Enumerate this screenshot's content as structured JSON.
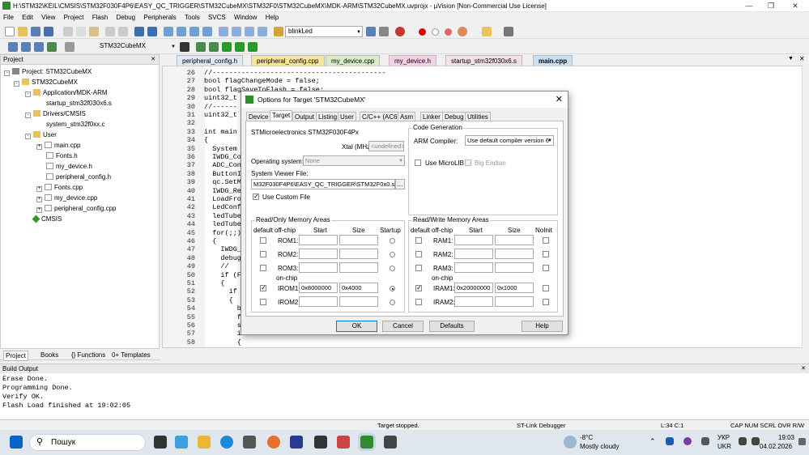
{
  "window": {
    "title": "H:\\STM32\\KEIL\\CMSIS\\STM32F030F4P6\\EASY_QC_TRIGGER\\STM32CubeMX\\STM32F0\\STM32CubeMX\\MDK-ARM\\STM32CubeMX.uvprojx - µVision  [Non-Commercial Use License]"
  },
  "menu": [
    "File",
    "Edit",
    "View",
    "Project",
    "Flash",
    "Debug",
    "Peripherals",
    "Tools",
    "SVCS",
    "Window",
    "Help"
  ],
  "toolbar": {
    "target_combo": "blinkLed",
    "project_combo": "STM32CubeMX"
  },
  "project_panel": {
    "header": "Project",
    "items": [
      {
        "label": "Project: STM32CubeMX",
        "level": 0,
        "kind": "root"
      },
      {
        "label": "STM32CubeMX",
        "level": 1,
        "kind": "folder"
      },
      {
        "label": "Application/MDK-ARM",
        "level": 2,
        "kind": "folder"
      },
      {
        "label": "startup_stm32f030x6.s",
        "level": 3,
        "kind": "file"
      },
      {
        "label": "Drivers/CMSIS",
        "level": 2,
        "kind": "folder"
      },
      {
        "label": "system_stm32f0xx.c",
        "level": 3,
        "kind": "file"
      },
      {
        "label": "User",
        "level": 2,
        "kind": "folder"
      },
      {
        "label": "main.cpp",
        "level": 3,
        "kind": "file"
      },
      {
        "label": "Fonts.h",
        "level": 3,
        "kind": "file"
      },
      {
        "label": "my_device.h",
        "level": 3,
        "kind": "file"
      },
      {
        "label": "peripheral_config.h",
        "level": 3,
        "kind": "file"
      },
      {
        "label": "Fonts.cpp",
        "level": 3,
        "kind": "file"
      },
      {
        "label": "my_device.cpp",
        "level": 3,
        "kind": "file"
      },
      {
        "label": "peripheral_config.cpp",
        "level": 3,
        "kind": "file"
      },
      {
        "label": "CMSIS",
        "level": 1,
        "kind": "gem"
      }
    ],
    "tabs": [
      "Project",
      "Books",
      "{} Functions",
      "0+ Templates"
    ]
  },
  "file_tabs": [
    "peripheral_config.h",
    "peripheral_config.cpp",
    "my_device.cpp",
    "my_device.h",
    "startup_stm32f030x6.s",
    "main.cpp"
  ],
  "editor": {
    "lines": [
      {
        "n": "26",
        "t": "//------------------------------------------"
      },
      {
        "n": "27",
        "t": "bool flagChangeMode = false;"
      },
      {
        "n": "28",
        "t": "bool flagSaveToFlash = false;"
      },
      {
        "n": "29",
        "t": "uint32_t"
      },
      {
        "n": "30",
        "t": "//------"
      },
      {
        "n": "31",
        "t": "uint32_t"
      },
      {
        "n": "32",
        "t": ""
      },
      {
        "n": "33",
        "t": "int main"
      },
      {
        "n": "34",
        "t": "{"
      },
      {
        "n": "35",
        "t": "  System"
      },
      {
        "n": "36",
        "t": "  IWDG_Co"
      },
      {
        "n": "37",
        "t": "  ADC_Con"
      },
      {
        "n": "38",
        "t": "  ButtonI"
      },
      {
        "n": "39",
        "t": "  qc.SetM"
      },
      {
        "n": "40",
        "t": "  IWDG_Re"
      },
      {
        "n": "41",
        "t": "  LoadFro"
      },
      {
        "n": "42",
        "t": "  LedConf"
      },
      {
        "n": "43",
        "t": "  ledTube"
      },
      {
        "n": "44",
        "t": "  ledTube"
      },
      {
        "n": "45",
        "t": "  for(;;)"
      },
      {
        "n": "46",
        "t": "  {"
      },
      {
        "n": "47",
        "t": "    IWDG_"
      },
      {
        "n": "48",
        "t": "    debug"
      },
      {
        "n": "49",
        "t": "    //"
      },
      {
        "n": "50",
        "t": "    if (F"
      },
      {
        "n": "51",
        "t": "    {"
      },
      {
        "n": "52",
        "t": "      if"
      },
      {
        "n": "53",
        "t": "      {"
      },
      {
        "n": "54",
        "t": "        b"
      },
      {
        "n": "55",
        "t": "        f"
      },
      {
        "n": "56",
        "t": "        s"
      },
      {
        "n": "57",
        "t": "        i"
      },
      {
        "n": "58",
        "t": "        {"
      }
    ]
  },
  "build_output": {
    "header": "Build Output",
    "lines": [
      "Erase Done.",
      "Programming Done.",
      "Verify OK.",
      "Flash Load finished at 19:02:05"
    ]
  },
  "status": {
    "target": "Target stopped.",
    "debugger": "ST-Link Debugger",
    "pos": "L:34 C:1",
    "keys": "CAP  NUM  SCRL  OVR  R/W"
  },
  "dialog": {
    "title": "Options for Target 'STM32CubeMX'",
    "tabs": [
      "Device",
      "Target",
      "Output",
      "Listing",
      "User",
      "C/C++ (AC6)",
      "Asm",
      "Linker",
      "Debug",
      "Utilities"
    ],
    "active_tab": "Target",
    "device_name": "STMicroelectronics STM32F030F4Px",
    "xtal_label": "Xtal (MHz):",
    "xtal_value": "<undefined>",
    "os_label": "Operating system:",
    "os_value": "None",
    "svd_label": "System Viewer File:",
    "svd_value": "M32F030F4P6\\EASY_QC_TRIGGER\\STM32F0x0.svd",
    "svd_browse": "...",
    "custom_file_label": "Use Custom File",
    "codegen_title": "Code Generation",
    "compiler_label": "ARM Compiler:",
    "compiler_value": "Use default compiler version 6",
    "microlib_label": "Use MicroLIB",
    "bigendian_label": "Big Endian",
    "rom": {
      "title": "Read/Only Memory Areas",
      "headers": [
        "default",
        "off-chip",
        "Start",
        "Size",
        "Startup"
      ],
      "onchip_label": "on-chip",
      "rows": [
        {
          "name": "ROM1:",
          "start": "",
          "size": "",
          "default": false,
          "startup": false
        },
        {
          "name": "ROM2:",
          "start": "",
          "size": "",
          "default": false,
          "startup": false
        },
        {
          "name": "ROM3:",
          "start": "",
          "size": "",
          "default": false,
          "startup": false
        },
        {
          "name": "IROM1:",
          "start": "0x8000000",
          "size": "0x4000",
          "default": true,
          "startup": true
        },
        {
          "name": "IROM2:",
          "start": "",
          "size": "",
          "default": false,
          "startup": false
        }
      ]
    },
    "ram": {
      "title": "Read/Write Memory Areas",
      "headers": [
        "default",
        "off-chip",
        "Start",
        "Size",
        "NoInit"
      ],
      "onchip_label": "on-chip",
      "rows": [
        {
          "name": "RAM1:",
          "start": "",
          "size": "",
          "default": false
        },
        {
          "name": "RAM2:",
          "start": "",
          "size": "",
          "default": false
        },
        {
          "name": "RAM3:",
          "start": "",
          "size": "",
          "default": false
        },
        {
          "name": "IRAM1:",
          "start": "0x20000000",
          "size": "0x1000",
          "default": true
        },
        {
          "name": "IRAM2:",
          "start": "",
          "size": "",
          "default": false
        }
      ]
    },
    "buttons": {
      "ok": "OK",
      "cancel": "Cancel",
      "defaults": "Defaults",
      "help": "Help"
    }
  },
  "taskbar": {
    "search": "Пошук",
    "weather_temp": "-8°C",
    "weather_desc": "Mostly cloudy",
    "lang1": "УКР",
    "lang2": "UKR",
    "time": "19:03",
    "date": "04.02.2026"
  }
}
